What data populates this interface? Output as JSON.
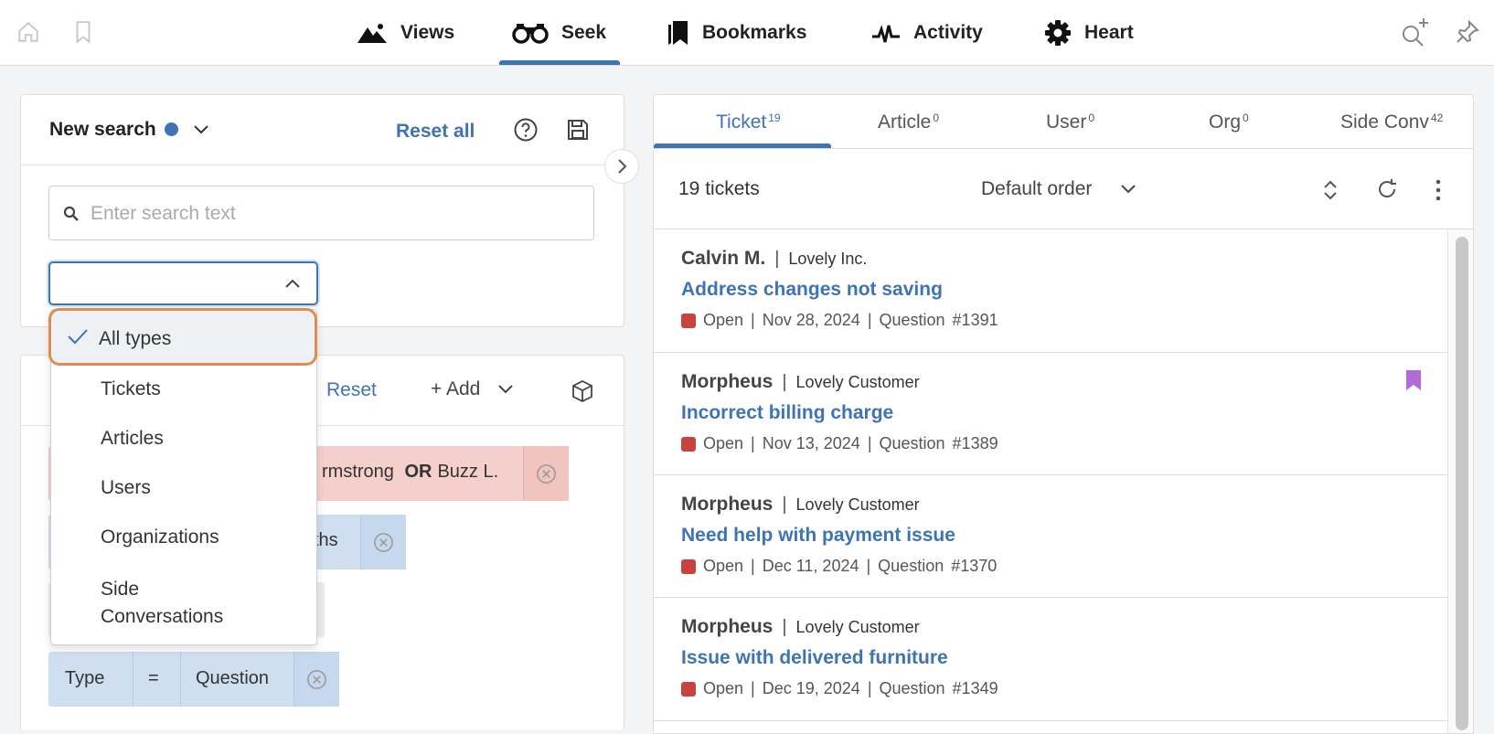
{
  "topnav": {
    "tabs": [
      {
        "label": "Views",
        "icon": "mountain-icon"
      },
      {
        "label": "Seek",
        "icon": "binoculars-icon",
        "active": true
      },
      {
        "label": "Bookmarks",
        "icon": "bookmarks-icon"
      },
      {
        "label": "Activity",
        "icon": "pulse-icon"
      },
      {
        "label": "Heart",
        "icon": "gear-icon"
      }
    ]
  },
  "search": {
    "title": "New search",
    "reset_all": "Reset all",
    "placeholder": "Enter search text",
    "type_select_value": ""
  },
  "filters": {
    "reset": "Reset",
    "add": "+ Add",
    "chip1_text": "rmstrong",
    "chip1_or": "OR",
    "chip1_text2": "Buzz L.",
    "chip2_text": "ths",
    "chip4": {
      "field": "Type",
      "op": "=",
      "value": "Question"
    }
  },
  "dropdown": {
    "options": [
      "All types",
      "Tickets",
      "Articles",
      "Users",
      "Organizations",
      "Side",
      "Conversations"
    ],
    "selected": "All types"
  },
  "results": {
    "tabs": [
      {
        "label": "Ticket",
        "count": "19"
      },
      {
        "label": "Article",
        "count": "0"
      },
      {
        "label": "User",
        "count": "0"
      },
      {
        "label": "Org",
        "count": "0"
      },
      {
        "label": "Side Conv",
        "count": "42"
      }
    ],
    "count_label": "19 tickets",
    "order": "Default order",
    "items": [
      {
        "name": "Calvin M.",
        "org": "Lovely Inc.",
        "title": "Address changes not saving",
        "status": "Open",
        "date": "Nov 28, 2024",
        "type": "Question",
        "id": "#1391",
        "bookmarked": false
      },
      {
        "name": "Morpheus",
        "org": "Lovely Customer",
        "title": "Incorrect billing charge",
        "status": "Open",
        "date": "Nov 13, 2024",
        "type": "Question",
        "id": "#1389",
        "bookmarked": true
      },
      {
        "name": "Morpheus",
        "org": "Lovely Customer",
        "title": "Need help with payment issue",
        "status": "Open",
        "date": "Dec 11, 2024",
        "type": "Question",
        "id": "#1370",
        "bookmarked": false
      },
      {
        "name": "Morpheus",
        "org": "Lovely Customer",
        "title": "Issue with delivered furniture",
        "status": "Open",
        "date": "Dec 19, 2024",
        "type": "Question",
        "id": "#1349",
        "bookmarked": false
      }
    ]
  },
  "colors": {
    "accent": "#3e73b4",
    "open_status": "#c8433f",
    "highlight": "#e38a4e",
    "bookmark": "#b36ad8"
  }
}
